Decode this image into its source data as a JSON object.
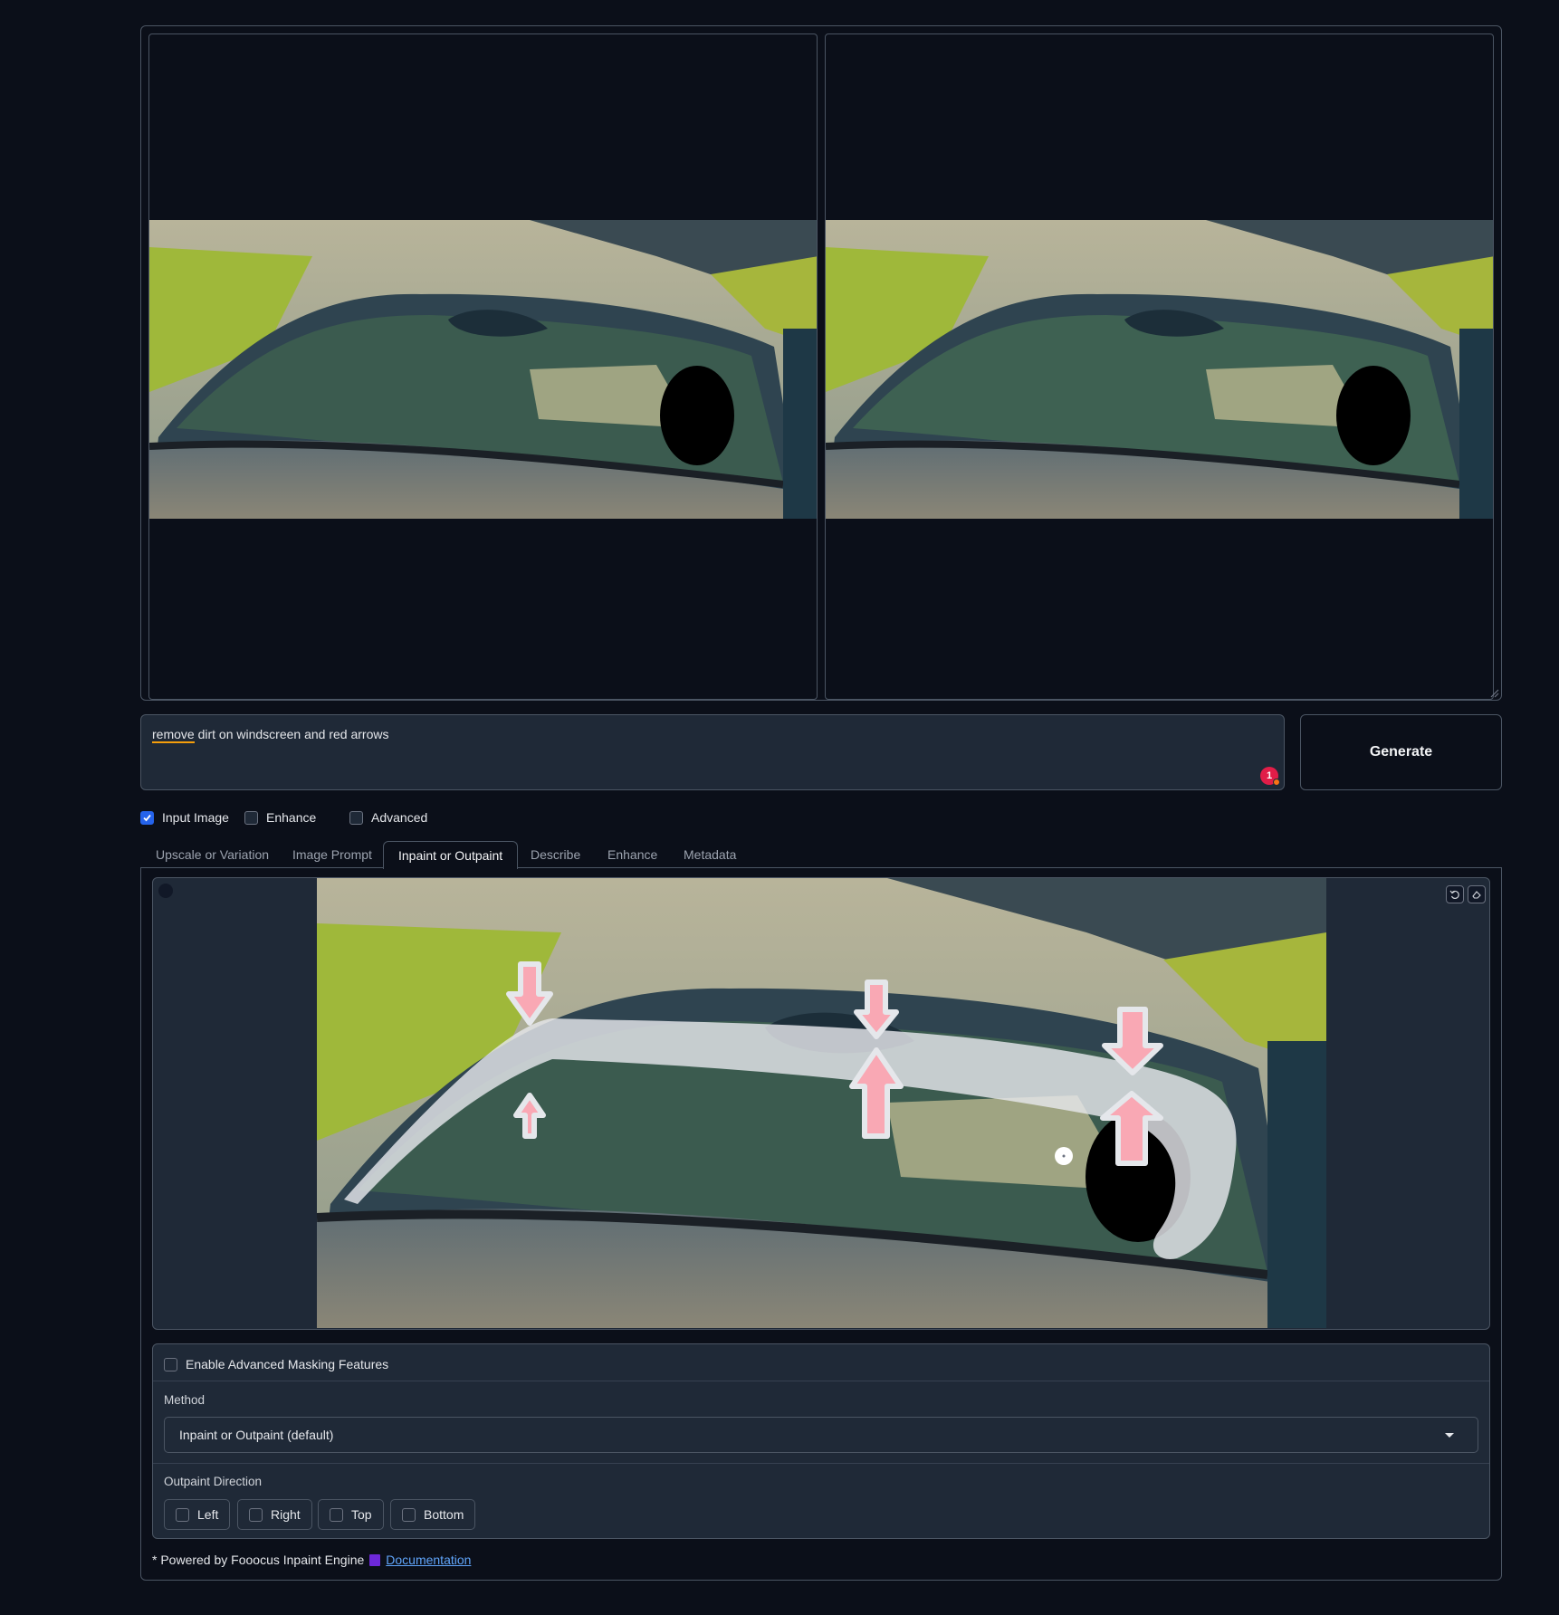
{
  "prompt": {
    "text_first_word": "remove",
    "text_rest": " dirt on windscreen and red arrows",
    "issue_count": "1"
  },
  "generate_label": "Generate",
  "options": [
    {
      "label": "Input Image",
      "checked": true
    },
    {
      "label": "Enhance",
      "checked": false
    },
    {
      "label": "Advanced",
      "checked": false
    }
  ],
  "tabs": [
    {
      "label": "Upscale or Variation",
      "active": false
    },
    {
      "label": "Image Prompt",
      "active": false
    },
    {
      "label": "Inpaint or Outpaint",
      "active": true
    },
    {
      "label": "Describe",
      "active": false
    },
    {
      "label": "Enhance",
      "active": false
    },
    {
      "label": "Metadata",
      "active": false
    }
  ],
  "editor_tools": [
    "undo-icon",
    "eraser-icon",
    "close-icon",
    "brush-icon"
  ],
  "masking": {
    "enable_label": "Enable Advanced Masking Features",
    "method_label": "Method",
    "method_value": "Inpaint or Outpaint (default)",
    "direction_label": "Outpaint Direction",
    "directions": [
      "Left",
      "Right",
      "Top",
      "Bottom"
    ]
  },
  "footer": {
    "text": "* Powered by Fooocus Inpaint Engine",
    "link": "Documentation"
  },
  "colors": {
    "background": "#0b0f19",
    "panel": "#1f2937",
    "border": "#4b5563",
    "checkbox_on": "#2563eb",
    "link": "#60a5fa"
  }
}
